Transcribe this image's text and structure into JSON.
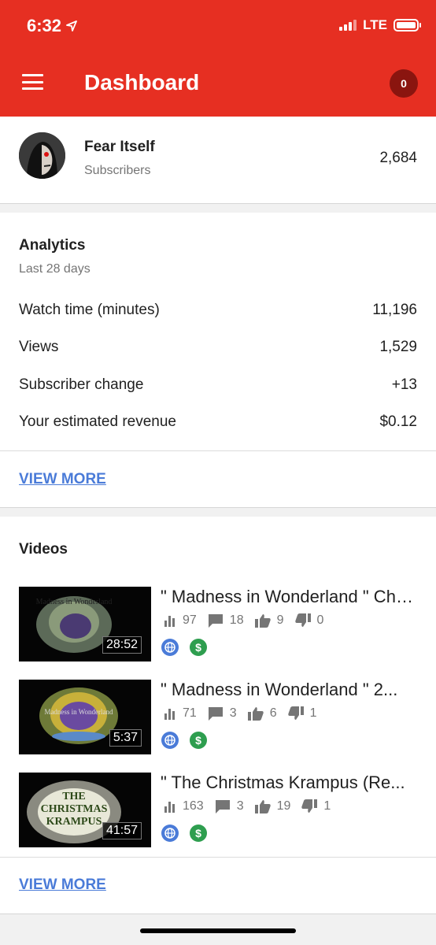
{
  "status_bar": {
    "time": "6:32",
    "network": "LTE"
  },
  "header": {
    "title": "Dashboard",
    "notification_count": "0"
  },
  "channel": {
    "name": "Fear Itself",
    "subscribers_label": "Subscribers",
    "subscribers": "2,684"
  },
  "analytics": {
    "title": "Analytics",
    "period": "Last 28 days",
    "metrics": [
      {
        "label": "Watch time (minutes)",
        "value": "11,196"
      },
      {
        "label": "Views",
        "value": "1,529"
      },
      {
        "label": "Subscriber change",
        "value": "+13"
      },
      {
        "label": "Your estimated revenue",
        "value": "$0.12"
      }
    ],
    "view_more": "VIEW MORE"
  },
  "videos": {
    "title": "Videos",
    "items": [
      {
        "title": "\" Madness in Wonderland \" Chapter",
        "duration": "28:52",
        "views": "97",
        "comments": "18",
        "likes": "9",
        "dislikes": "0",
        "thumb_text": "Madness in Wonderland"
      },
      {
        "title": "\" Madness in Wonderland \" 2...",
        "duration": "5:37",
        "views": "71",
        "comments": "3",
        "likes": "6",
        "dislikes": "1",
        "thumb_text": "Madness in Wonderland"
      },
      {
        "title": "\" The Christmas Krampus (Re...",
        "duration": "41:57",
        "views": "163",
        "comments": "3",
        "likes": "19",
        "dislikes": "1",
        "thumb_text": "THE CHRISTMAS KRAMPUS"
      }
    ],
    "view_more": "VIEW MORE"
  },
  "colors": {
    "header": "#e62f22",
    "link": "#4a7bd8",
    "public_badge": "#4a7bd8",
    "monetized_badge": "#2e9e4f"
  }
}
